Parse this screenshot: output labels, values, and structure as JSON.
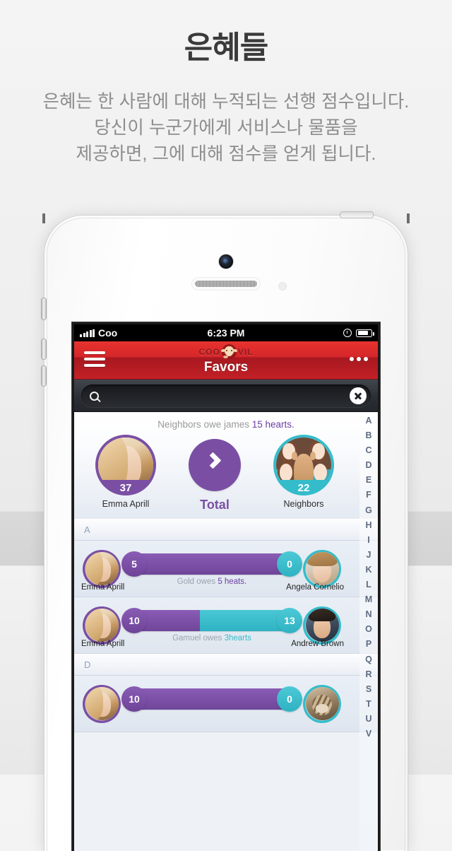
{
  "promo": {
    "title": "은혜들",
    "subtitle_lines": [
      "은혜는 한 사람에 대해 누적되는 선행 점수입니다.",
      "당신이 누군가에게 서비스나 물품을",
      "제공하면, 그에 대해 점수를 얻게 됩니다."
    ]
  },
  "statusbar": {
    "carrier": "Coo",
    "time": "6:23 PM",
    "alarm_icon": "clock-icon",
    "battery_icon": "battery-icon",
    "signal_icon": "signal-bars-icon"
  },
  "navbar": {
    "menu_icon": "hamburger-menu-icon",
    "logo_left": "COO",
    "logo_right": "VIL",
    "logo_mark": "cow-head-icon",
    "title": "Favors",
    "more_icon": "more-options-icon"
  },
  "search": {
    "icon": "search-icon",
    "value": "",
    "placeholder": "",
    "clear_icon": "clear-icon"
  },
  "summary": {
    "line_prefix": "Neighbors owe james",
    "line_highlight": "15 hearts.",
    "left": {
      "name": "Emma Aprill",
      "count": "37",
      "avatar": "emma-avatar"
    },
    "center": {
      "label": "Total",
      "icon": "chevron-right-icon"
    },
    "right": {
      "name": "Neighbors",
      "count": "22",
      "avatar": "neighbors-group-avatar"
    }
  },
  "sections": [
    {
      "letter": "A",
      "rows": [
        {
          "left_name": "Emma Aprill",
          "left_value": "5",
          "right_name": "Angela Cornelio",
          "right_value": "0",
          "caption_prefix": "Gold owes",
          "caption_highlight": "5 heats.",
          "caption_color": "#6b3fa0",
          "fill_percent": 100,
          "left_avatar": "emma-avatar",
          "right_avatar": "angela-avatar"
        },
        {
          "left_name": "Emma Aprill",
          "left_value": "10",
          "right_name": "Andrew Brown",
          "right_value": "13",
          "caption_prefix": "Gamuel owes",
          "caption_highlight": "3hearts",
          "caption_color": "#35bccb",
          "fill_percent": 43,
          "left_avatar": "emma-avatar",
          "right_avatar": "andrew-avatar"
        }
      ]
    },
    {
      "letter": "D",
      "rows": [
        {
          "left_name": "",
          "left_value": "10",
          "right_name": "",
          "right_value": "0",
          "caption_prefix": "",
          "caption_highlight": "",
          "caption_color": "#6b3fa0",
          "fill_percent": 100,
          "left_avatar": "emma-avatar",
          "right_avatar": "cat-avatar"
        }
      ]
    }
  ],
  "index_letters": [
    "A",
    "B",
    "C",
    "D",
    "E",
    "F",
    "G",
    "H",
    "I",
    "J",
    "K",
    "L",
    "M",
    "N",
    "O",
    "P",
    "Q",
    "R",
    "S",
    "T",
    "U",
    "V"
  ],
  "colors": {
    "accent_purple": "#7a4fa3",
    "accent_teal": "#35bccb",
    "navbar_red": "#d4262a",
    "searchbar_dark": "#2b2f35"
  }
}
